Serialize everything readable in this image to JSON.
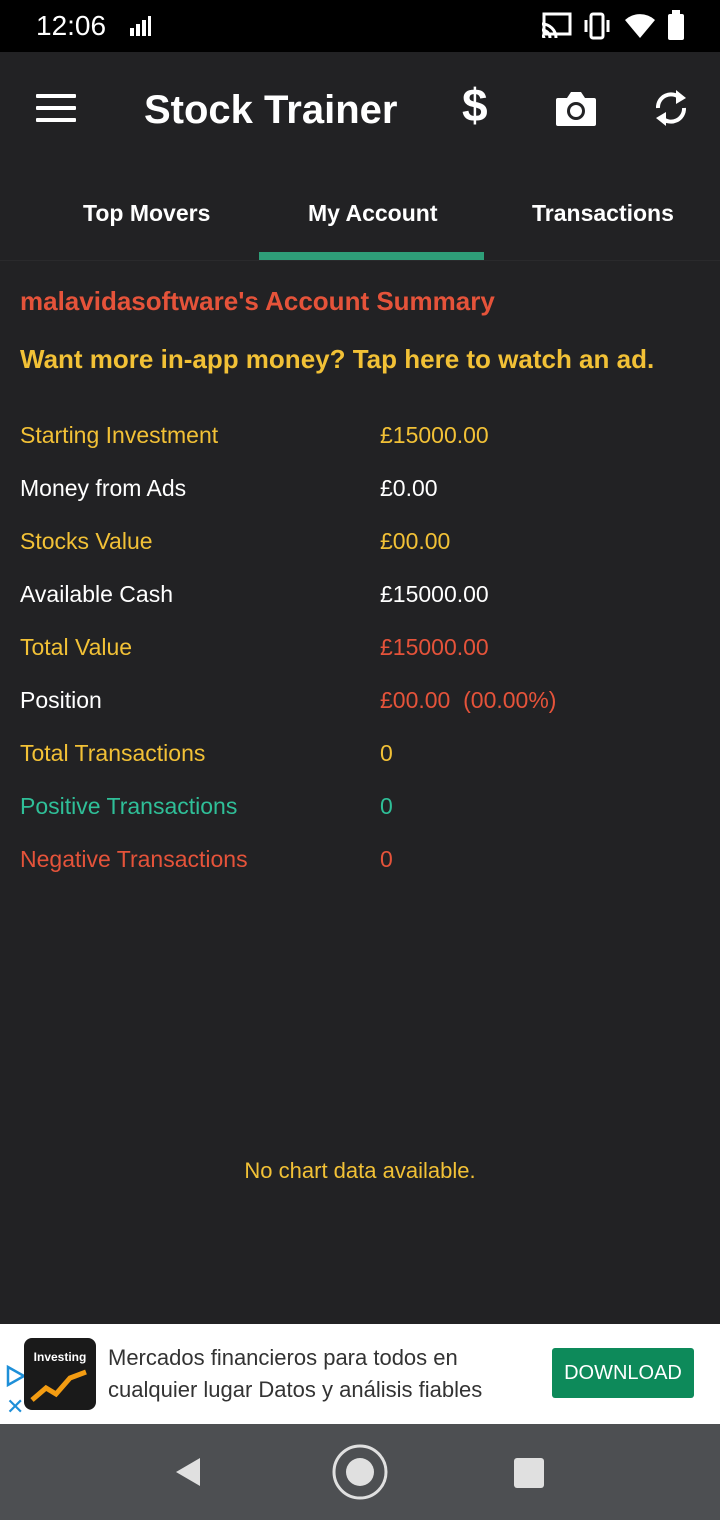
{
  "status_bar": {
    "time": "12:06"
  },
  "app_bar": {
    "title": "Stock Trainer",
    "dollar_symbol": "$"
  },
  "tabs": [
    {
      "label": "Top Movers"
    },
    {
      "label": "My Account",
      "selected": true
    },
    {
      "label": "Transactions"
    }
  ],
  "account": {
    "title": "malavidasoftware's Account Summary",
    "ad_prompt": "Want more in-app money? Tap here to watch an ad.",
    "rows": [
      {
        "label": "Starting Investment",
        "value": "£15000.00"
      },
      {
        "label": "Money from Ads",
        "value": "£0.00"
      },
      {
        "label": "Stocks Value",
        "value": "£00.00"
      },
      {
        "label": "Available Cash",
        "value": "£15000.00"
      },
      {
        "label": "Total Value",
        "value": "£15000.00"
      },
      {
        "label": "Position",
        "value": "£00.00  (00.00%)"
      },
      {
        "label": "Total Transactions",
        "value": "0"
      },
      {
        "label": "Positive Transactions",
        "value": "0"
      },
      {
        "label": "Negative Transactions",
        "value": "0"
      }
    ]
  },
  "chart": {
    "empty_message": "No chart data available."
  },
  "ad_banner": {
    "logo_text": "Investing",
    "text": "Mercados financieros para todos en cualquier lugar Datos y análisis fiables",
    "cta": "DOWNLOAD"
  },
  "colors": {
    "background": "#222224",
    "accent_green": "#2e9e78",
    "label_yellow": "#f2c136",
    "negative_red": "#e5533a",
    "positive_green": "#2fbf98"
  }
}
